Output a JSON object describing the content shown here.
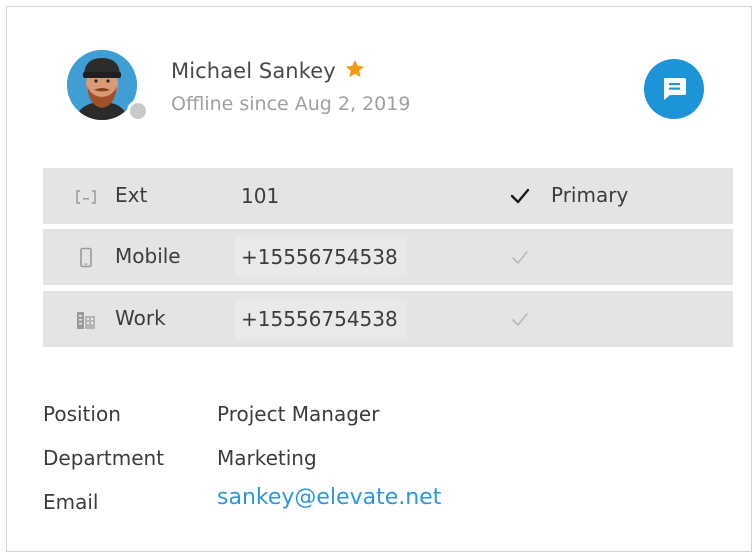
{
  "contact": {
    "name": "Michael Sankey",
    "status": "Offline since Aug 2, 2019",
    "is_favorite": true,
    "presence": "offline"
  },
  "phones": [
    {
      "type": "Ext",
      "icon": "extension-icon",
      "number": "101",
      "primary": true,
      "primary_label": "Primary"
    },
    {
      "type": "Mobile",
      "icon": "mobile-phone-icon",
      "number": "+15556754538",
      "primary": false
    },
    {
      "type": "Work",
      "icon": "office-building-icon",
      "number": "+15556754538",
      "primary": false
    }
  ],
  "details": [
    {
      "label": "Position",
      "value": "Project Manager"
    },
    {
      "label": "Department",
      "value": "Marketing"
    },
    {
      "label": "Email",
      "value": "sankey@elevate.net"
    }
  ],
  "colors": {
    "accent": "#1d93d8",
    "link": "#2f97d6",
    "star": "#f39a12",
    "row_bg": "#e4e4e4",
    "presence_offline": "#c9c9c9"
  }
}
